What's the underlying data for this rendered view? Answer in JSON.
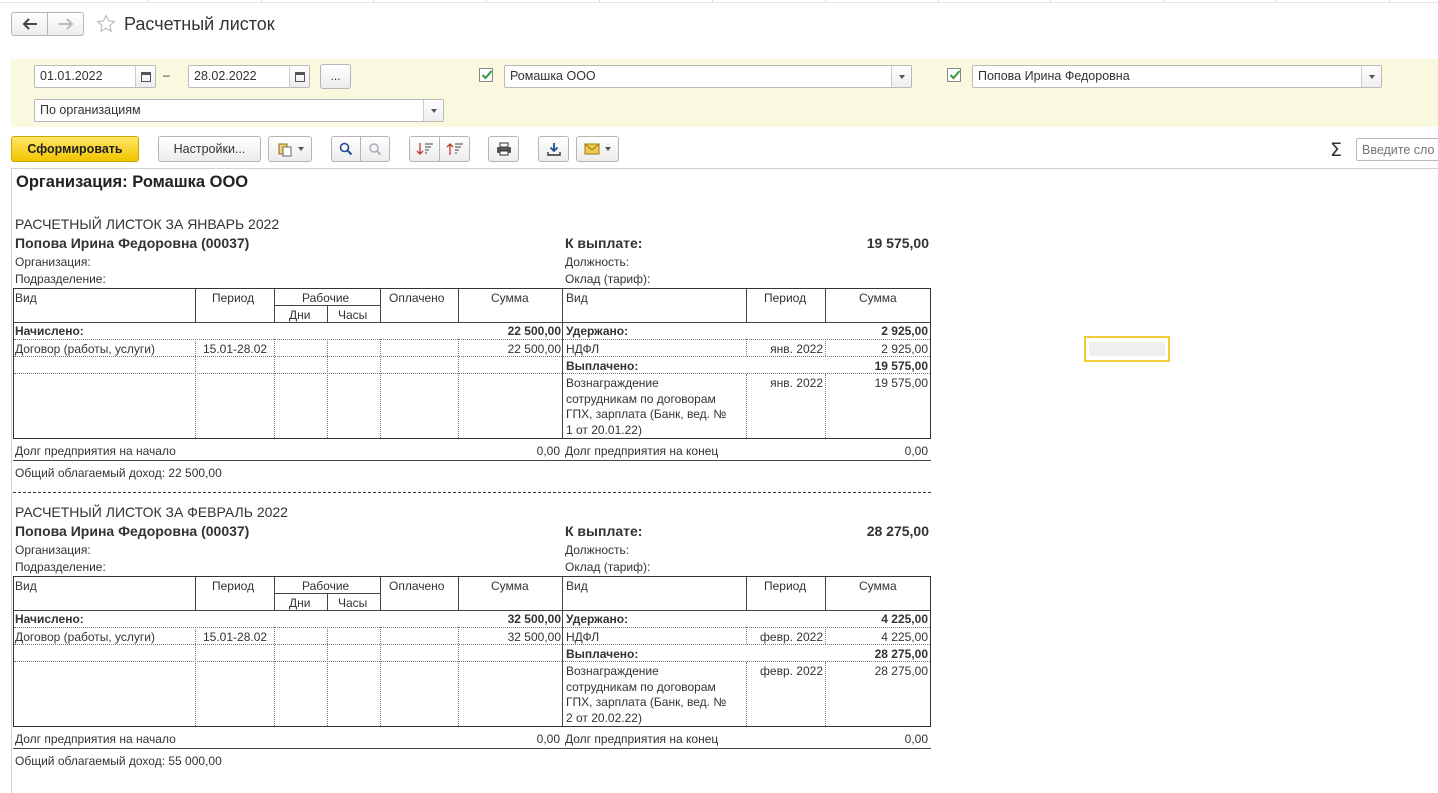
{
  "window": {
    "title": "Расчетный листок"
  },
  "filters": {
    "date_from": "01.01.2022",
    "date_sep": "–",
    "date_to": "28.02.2022",
    "more_label": "...",
    "organization": "Ромашка ООО",
    "organization_checked": true,
    "employee": "Попова Ирина Федоровна",
    "employee_checked": true,
    "grouping": "По организациям"
  },
  "toolbar": {
    "generate_label": "Сформировать",
    "settings_label": "Настройки...",
    "sum_symbol": "Σ",
    "search_placeholder": "Введите сло"
  },
  "report": {
    "organization_header": "Организация: Ромашка ООО",
    "labels": {
      "employee_org": "Организация:",
      "department": "Подразделение:",
      "to_pay": "К выплате:",
      "position": "Должность:",
      "salary": "Оклад (тариф):",
      "col_kind": "Вид",
      "col_period": "Период",
      "col_working": "Рабочие",
      "col_days": "Дни",
      "col_hours": "Часы",
      "col_paid": "Оплачено",
      "col_sum": "Сумма",
      "accrued": "Начислено:",
      "withheld": "Удержано:",
      "paid_out": "Выплачено:",
      "debt_start": "Долг предприятия на начало",
      "debt_end": "Долг предприятия на конец"
    },
    "sheets": [
      {
        "heading": "РАСЧЕТНЫЙ ЛИСТОК ЗА ЯНВАРЬ 2022",
        "employee": "Попова Ирина Федоровна (00037)",
        "to_pay": "19 575,00",
        "accrued_total": "22 500,00",
        "accrual_kind": "Договор (работы, услуги)",
        "accrual_period": "15.01-28.02",
        "accrual_sum": "22 500,00",
        "withheld_total": "2 925,00",
        "withhold_kind": "НДФЛ",
        "withhold_period": "янв. 2022",
        "withhold_sum": "2 925,00",
        "paid_out_total": "19 575,00",
        "payment_kind": "Вознаграждение сотрудникам по договорам ГПХ, зарплата (Банк, вед. № 1 от 20.01.22)",
        "payment_line1": "Вознаграждение",
        "payment_line2": "сотрудникам по договорам",
        "payment_line3": "ГПХ, зарплата (Банк, вед. №",
        "payment_line4": "1 от 20.01.22)",
        "payment_period": "янв. 2022",
        "payment_sum": "19 575,00",
        "debt_start": "0,00",
        "debt_end": "0,00",
        "taxable_income": "Общий облагаемый доход: 22 500,00"
      },
      {
        "heading": "РАСЧЕТНЫЙ ЛИСТОК ЗА ФЕВРАЛЬ 2022",
        "employee": "Попова Ирина Федоровна (00037)",
        "to_pay": "28 275,00",
        "accrued_total": "32 500,00",
        "accrual_kind": "Договор (работы, услуги)",
        "accrual_period": "15.01-28.02",
        "accrual_sum": "32 500,00",
        "withheld_total": "4 225,00",
        "withhold_kind": "НДФЛ",
        "withhold_period": "февр. 2022",
        "withhold_sum": "4 225,00",
        "paid_out_total": "28 275,00",
        "payment_line1": "Вознаграждение",
        "payment_line2": "сотрудникам по договорам",
        "payment_line3": "ГПХ, зарплата (Банк, вед. №",
        "payment_line4": "2 от 20.02.22)",
        "payment_period": "февр. 2022",
        "payment_sum": "28 275,00",
        "debt_start": "0,00",
        "debt_end": "0,00",
        "taxable_income": "Общий облагаемый доход: 55 000,00"
      }
    ]
  },
  "colors": {
    "filter_panel": "#fbf8e0",
    "primary_button": "#f2c500",
    "checkbox_tick": "#2e9a3a",
    "selected_cell": "#f2cc34"
  },
  "icons": [
    "back-arrow-icon",
    "forward-arrow-icon",
    "favorite-star-icon",
    "calendar-icon",
    "chevron-down-icon",
    "copy-icon",
    "find-icon",
    "find-next-icon",
    "sort-desc-icon",
    "sort-asc-icon",
    "print-icon",
    "download-icon",
    "email-icon",
    "sum-icon"
  ]
}
